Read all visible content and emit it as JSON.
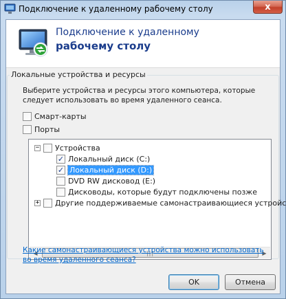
{
  "window": {
    "title": "Подключение к удаленному рабочему столу",
    "close_glyph": "x"
  },
  "header": {
    "line1": "Подключение к удаленному",
    "line2": "рабочему столу",
    "logo_icon": "remote-desktop-icon"
  },
  "local_resources": {
    "group_label": "Локальные устройства и ресурсы",
    "description": "Выберите устройства и ресурсы этого компьютера, которые следует использовать во время удаленного сеанса.",
    "options": [
      {
        "label": "Смарт-карты",
        "checked": false
      },
      {
        "label": "Порты",
        "checked": false
      }
    ]
  },
  "tree": {
    "root": {
      "label": "Устройства",
      "expander": "−",
      "checked": false
    },
    "items": [
      {
        "label": "Локальный диск (C:)",
        "checked": true,
        "selected": false
      },
      {
        "label": "Локальный диск (D:)",
        "checked": true,
        "selected": true
      },
      {
        "label": "DVD RW дисковод (E:)",
        "checked": false,
        "selected": false
      },
      {
        "label": "Дисководы, которые будут подключены позже",
        "checked": false,
        "selected": false
      }
    ],
    "other": {
      "label": "Другие поддерживаемые самонастраивающиеся устройства",
      "expander": "+",
      "checked": false
    },
    "scroll_left": "◀",
    "scroll_right": "▶",
    "thumb_grip": "|||"
  },
  "link_text": "Какие самонастраивающиеся устройства можно использовать во время удаленного сеанса?",
  "buttons": {
    "ok": "OK",
    "cancel": "Отмена"
  },
  "colors": {
    "selection": "#3399ff",
    "link": "#0066cc",
    "header_text": "#1a3c8c"
  }
}
